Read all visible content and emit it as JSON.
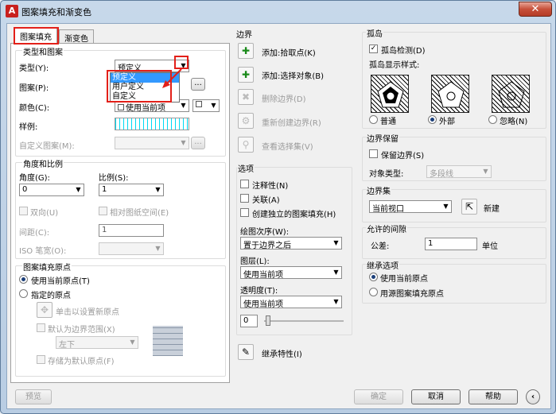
{
  "window": {
    "title": "图案填充和渐变色",
    "close": "✕"
  },
  "tabs": {
    "hatch": "图案填充",
    "gradient": "渐变色"
  },
  "type_pattern": {
    "title": "类型和图案",
    "type_label": "类型(Y):",
    "type_value": "预定义",
    "options": [
      "预定义",
      "用户定义",
      "自定义"
    ],
    "pattern_label": "图案(P):",
    "browse": "...",
    "color_label": "颜色(C):",
    "color_value": "使用当前项",
    "swatch_label": "样例:",
    "custom_label": "自定义图案(M):"
  },
  "angle_scale": {
    "title": "角度和比例",
    "angle_label": "角度(G):",
    "angle_value": "0",
    "scale_label": "比例(S):",
    "scale_value": "1",
    "double_label": "双向(U)",
    "relative_label": "相对图纸空间(E)",
    "spacing_label": "间距(C):",
    "spacing_value": "1",
    "iso_label": "ISO 笔宽(O):"
  },
  "origin": {
    "title": "图案填充原点",
    "current_label": "使用当前原点(T)",
    "specified_label": "指定的原点",
    "click_label": "单击以设置新原点",
    "default_extent_label": "默认为边界范围(X)",
    "extent_value": "左下",
    "store_label": "存储为默认原点(F)"
  },
  "boundaries": {
    "title": "边界",
    "pick": "添加:拾取点(K)",
    "select": "添加:选择对象(B)",
    "remove": "删除边界(D)",
    "recreate": "重新创建边界(R)",
    "view": "查看选择集(V)"
  },
  "options": {
    "title": "选项",
    "annotative": "注释性(N)",
    "associative": "关联(A)",
    "separate": "创建独立的图案填充(H)",
    "draw_order_label": "绘图次序(W):",
    "draw_order_value": "置于边界之后",
    "layer_label": "图层(L):",
    "layer_value": "使用当前项",
    "transparency_label": "透明度(T):",
    "transparency_value": "使用当前项",
    "transparency_number": "0"
  },
  "inherit": {
    "label": "继承特性(I)"
  },
  "islands": {
    "title": "孤岛",
    "detect": "孤岛检测(D)",
    "style_label": "孤岛显示样式:",
    "normal": "普通",
    "outer": "外部",
    "ignore": "忽略(N)"
  },
  "retain": {
    "title": "边界保留",
    "retain_label": "保留边界(S)",
    "object_type_label": "对象类型:",
    "object_type_value": "多段线"
  },
  "boundary_set": {
    "title": "边界集",
    "value": "当前视口",
    "new_label": "新建"
  },
  "gap": {
    "title": "允许的间隙",
    "tolerance_label": "公差:",
    "tolerance_value": "1",
    "unit": "单位"
  },
  "inherit_options": {
    "title": "继承选项",
    "use_current": "使用当前原点",
    "use_source": "用源图案填充原点"
  },
  "footer": {
    "preview": "预览",
    "ok": "确定",
    "cancel": "取消",
    "help": "帮助",
    "collapse": "‹"
  }
}
